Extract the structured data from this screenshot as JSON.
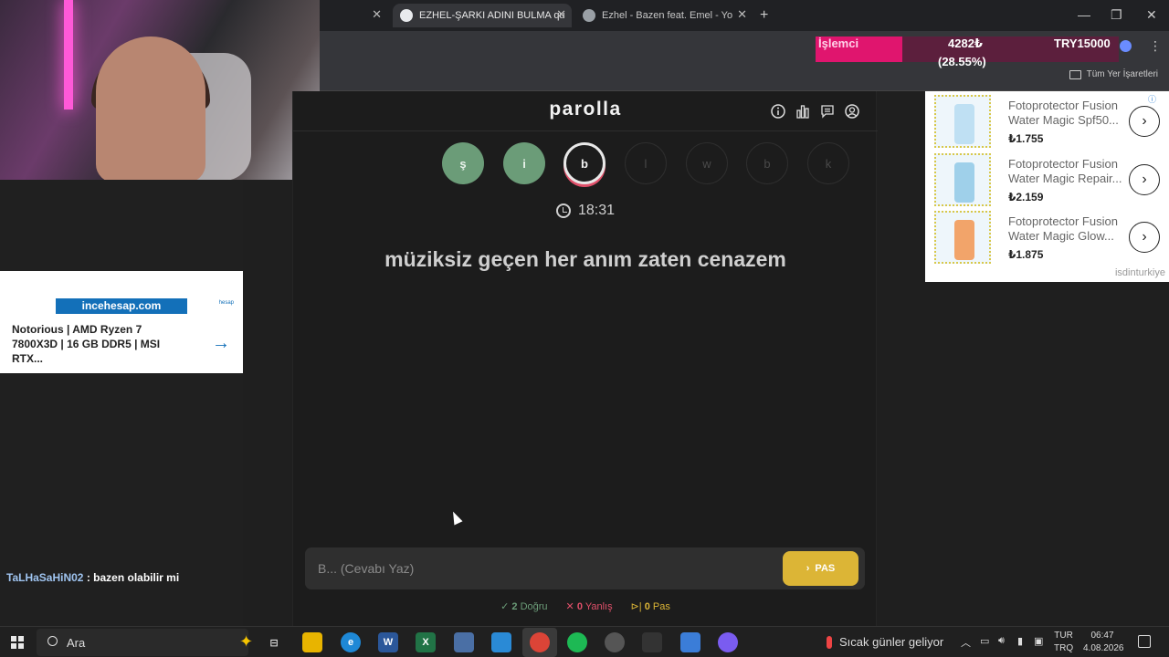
{
  "browser": {
    "tabs": [
      {
        "title": "",
        "active": false
      },
      {
        "title": "EZHEL-ŞARKI ADINI BULMA qu",
        "active": true
      },
      {
        "title": "Ezhel - Bazen feat. Emel - Yo",
        "active": false
      }
    ],
    "bookmarks_all": "Tüm Yer İşaretleri"
  },
  "cpu_overlay": {
    "label": "İşlemci",
    "value": "4282₺",
    "percent": "(28.55%)",
    "percent_value": 28.55,
    "money": "TRY15000",
    "accent_color": "#e0156e"
  },
  "game": {
    "logo": "parolla",
    "letters": [
      {
        "char": "ş",
        "state": "done"
      },
      {
        "char": "i",
        "state": "done"
      },
      {
        "char": "b",
        "state": "current"
      },
      {
        "char": "l",
        "state": "todo"
      },
      {
        "char": "w",
        "state": "todo"
      },
      {
        "char": "b",
        "state": "todo"
      },
      {
        "char": "k",
        "state": "todo"
      }
    ],
    "timer": "18:31",
    "lyric": "müziksiz geçen her anım zaten cenazem",
    "answer_placeholder": "B... (Cevabı Yaz)",
    "pass_label": "PAS",
    "stats": {
      "correct_count": "2",
      "correct_label": "Doğru",
      "wrong_count": "0",
      "wrong_label": "Yanlış",
      "pass_count": "0",
      "pass_label": "Pas"
    },
    "colors": {
      "done": "#6b9c78",
      "pass": "#dcb536",
      "wrong": "#e0506a"
    }
  },
  "left_ad": {
    "brand": "incehesap.com",
    "mini": "hesap",
    "text": "Notorious | AMD Ryzen 7 7800X3D | 16 GB DDR5 | MSI RTX..."
  },
  "chat": {
    "user": "TaLHaSaHiN02",
    "message": ": bazen olabilir mi"
  },
  "right_ad": {
    "brand": "isdinturkiye",
    "products": [
      {
        "title": "Fotoprotector Fusion Water Magic Spf50...",
        "price": "₺1.755"
      },
      {
        "title": "Fotoprotector Fusion Water Magic Repair...",
        "price": "₺2.159"
      },
      {
        "title": "Fotoprotector Fusion Water Magic Glow...",
        "price": "₺1.875"
      }
    ]
  },
  "taskbar": {
    "search": "Ara",
    "weather": "Sıcak günler geliyor",
    "lang_top": "TUR",
    "lang_bottom": "TRQ",
    "time": "06:47",
    "date": "4.08.2026"
  }
}
